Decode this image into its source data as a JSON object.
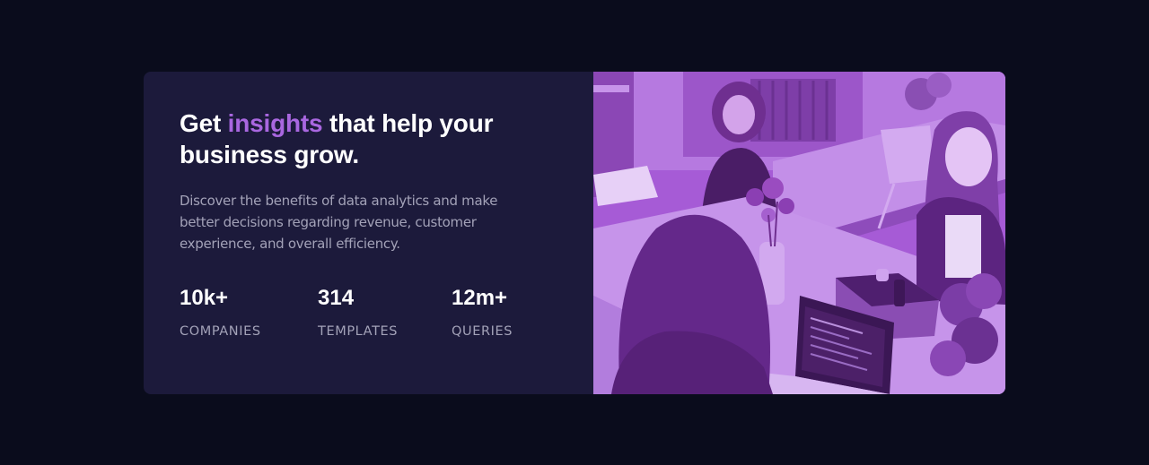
{
  "card": {
    "headline": {
      "part1": "Get ",
      "accent": "insights",
      "part2": " that help your business grow."
    },
    "description": "Discover the benefits of data analytics and make better decisions regarding revenue, customer experience, and overall efficiency.",
    "stats": [
      {
        "value": "10k+",
        "label": "COMPANIES"
      },
      {
        "value": "314",
        "label": "TEMPLATES"
      },
      {
        "value": "12m+",
        "label": "QUERIES"
      }
    ]
  },
  "image": {
    "description_icon": "office-team-photo",
    "tint_color": "#aa5cdb"
  },
  "colors": {
    "page_background": "#0a0c1c",
    "card_background": "#1c1a3b",
    "accent": "#a967e0",
    "muted_text": "#a3a2b8"
  }
}
